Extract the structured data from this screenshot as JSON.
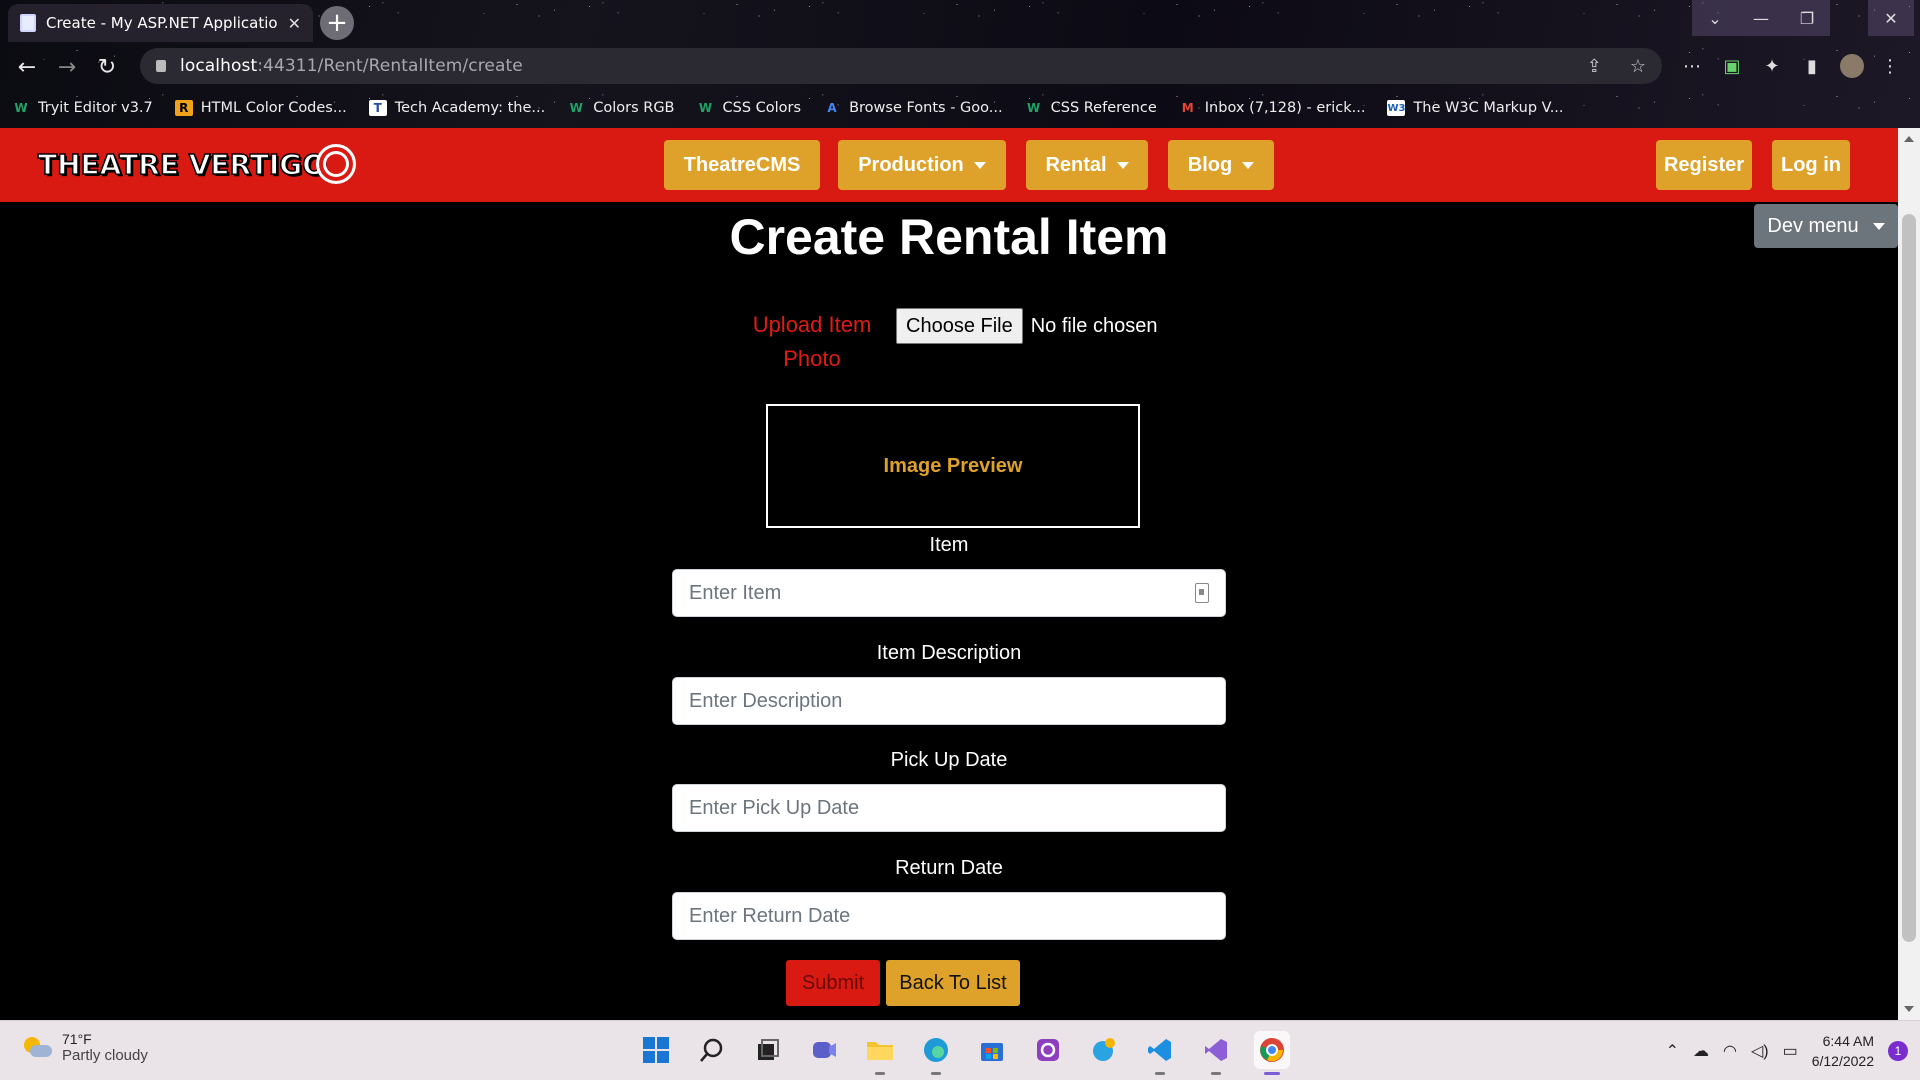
{
  "browser": {
    "tab_title": "Create - My ASP.NET Application",
    "tab_close": "✕",
    "new_tab": "+",
    "url_host": "localhost",
    "url_rest": ":44311/Rent/RentalItem/create",
    "bookmarks": [
      {
        "label": "Tryit Editor v3.7",
        "icon": "w3-icon",
        "color": "#21a366"
      },
      {
        "label": "HTML Color Codes...",
        "icon": "r-icon",
        "color": "#f0a31a"
      },
      {
        "label": "Tech Academy: the...",
        "icon": "ta-icon",
        "color": "#1f4e9e"
      },
      {
        "label": "Colors RGB",
        "icon": "w3-icon",
        "color": "#21a366"
      },
      {
        "label": "CSS Colors",
        "icon": "w3-icon",
        "color": "#21a366"
      },
      {
        "label": "Browse Fonts - Goo...",
        "icon": "fonts-icon",
        "color": "#4285f4"
      },
      {
        "label": "CSS Reference",
        "icon": "w3-icon",
        "color": "#21a366"
      },
      {
        "label": "Inbox (7,128) - erick...",
        "icon": "gmail-icon",
        "color": "#ea4335"
      },
      {
        "label": "The W3C Markup V...",
        "icon": "w3c-icon",
        "color": "#1a5fb4"
      }
    ]
  },
  "site": {
    "logo_text": "THEATRE VERTIGO",
    "nav": {
      "theatrecms": "TheatreCMS",
      "production": "Production",
      "rental": "Rental",
      "blog": "Blog",
      "register": "Register",
      "login": "Log in"
    },
    "dev_menu": "Dev menu",
    "colors": {
      "navbar": "#d91a12",
      "accent": "#dea22a",
      "dev_menu": "#6d757c"
    }
  },
  "form": {
    "title": "Create Rental Item",
    "upload_label": "Upload Item Photo",
    "choose_file": "Choose File",
    "file_status": "No file chosen",
    "image_preview": "Image Preview",
    "item_label": "Item",
    "item_placeholder": "Enter Item",
    "description_label": "Item Description",
    "description_placeholder": "Enter Description",
    "pickup_label": "Pick Up Date",
    "pickup_placeholder": "Enter Pick Up Date",
    "return_label": "Return Date",
    "return_placeholder": "Enter Return Date",
    "submit": "Submit",
    "back": "Back To List"
  },
  "taskbar": {
    "temperature": "71°F",
    "weather": "Partly cloudy",
    "time": "6:44 AM",
    "date": "6/12/2022",
    "notifications": "1"
  }
}
